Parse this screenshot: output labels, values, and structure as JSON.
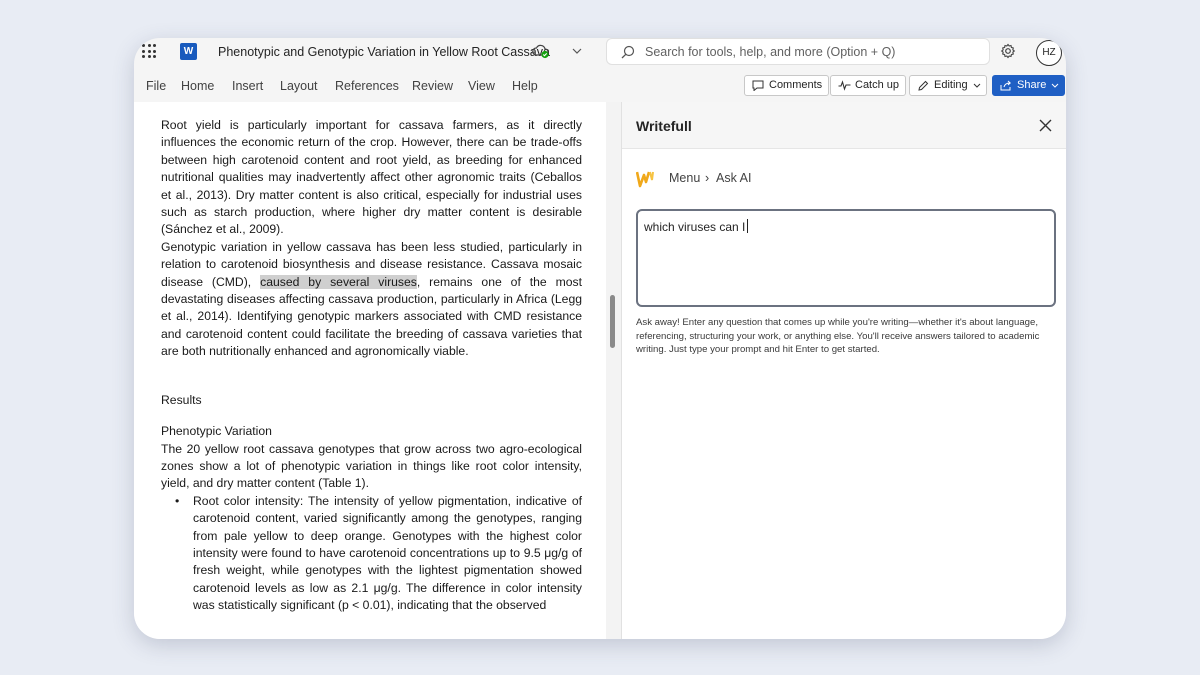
{
  "titlebar": {
    "document_title": "Phenotypic and Genotypic Variation in Yellow Root Cassava",
    "app_logo_letter": "W",
    "search_placeholder": "Search for tools, help, and more (Option + Q)",
    "avatar_initials": "HZ"
  },
  "ribbon": {
    "tabs": [
      "File",
      "Home",
      "Insert",
      "Layout",
      "References",
      "Review",
      "View",
      "Help"
    ],
    "comments_label": "Comments",
    "catchup_label": "Catch up",
    "editing_label": "Editing",
    "share_label": "Share",
    "share_color": "#1f5fc4"
  },
  "document": {
    "para1": "Root yield is particularly important for cassava farmers, as it directly influences the economic return of the crop. However, there can be trade-offs between high carotenoid content and root yield, as breeding for enhanced nutritional qualities may inadvertently affect other agronomic traits (Ceballos et al., 2013). Dry matter content is also critical, especially for industrial uses such as starch production, where higher dry matter content is desirable (Sánchez et al., 2009).",
    "para2_before": "Genotypic variation in yellow cassava has been less studied, particularly in relation to carotenoid biosynthesis and disease resistance. Cassava mosaic disease (CMD), ",
    "para2_highlight": "caused by several viruses",
    "para2_after": ", remains one of the most devastating diseases affecting cassava production, particularly in Africa (Legg et al., 2014). Identifying genotypic markers associated with CMD resistance and carotenoid content could facilitate the breeding of cassava varieties that are both nutritionally enhanced and agronomically viable.",
    "results_heading": "Results",
    "subheading": "Phenotypic Variation",
    "para3": "The 20 yellow root cassava genotypes that grow across two agro-ecological zones show a lot of phenotypic variation in things like root color intensity, yield, and dry matter content (Table 1).",
    "bullet_term": "Root color intensity",
    "bullet_text": ": The intensity of yellow pigmentation, indicative of carotenoid content, varied significantly among the genotypes, ranging from pale yellow to deep orange. Genotypes with the highest color intensity were found to have carotenoid concentrations up to 9.5 μg/g of fresh weight, while genotypes with the lightest pigmentation showed carotenoid levels as low as 2.1 μg/g. The difference in color intensity was statistically significant (p < 0.01), indicating that the observed"
  },
  "writefull": {
    "title": "Writefull",
    "crumb_menu": "Menu",
    "crumb_sep": "›",
    "crumb_current": "Ask AI",
    "input_value": "which viruses can I",
    "hint": "Ask away! Enter any question that comes up while you're writing—whether it's about language, referencing, structuring your work, or anything else. You'll receive answers tailored to academic writing. Just type your prompt and hit Enter to get started."
  },
  "icons": [
    "waffle-icon",
    "word-logo-icon",
    "cloud-saved-icon",
    "chevron-down-icon",
    "search-icon",
    "gear-icon",
    "comment-icon",
    "catchup-icon",
    "pencil-icon",
    "share-icon",
    "close-icon",
    "writefull-logo-icon"
  ]
}
